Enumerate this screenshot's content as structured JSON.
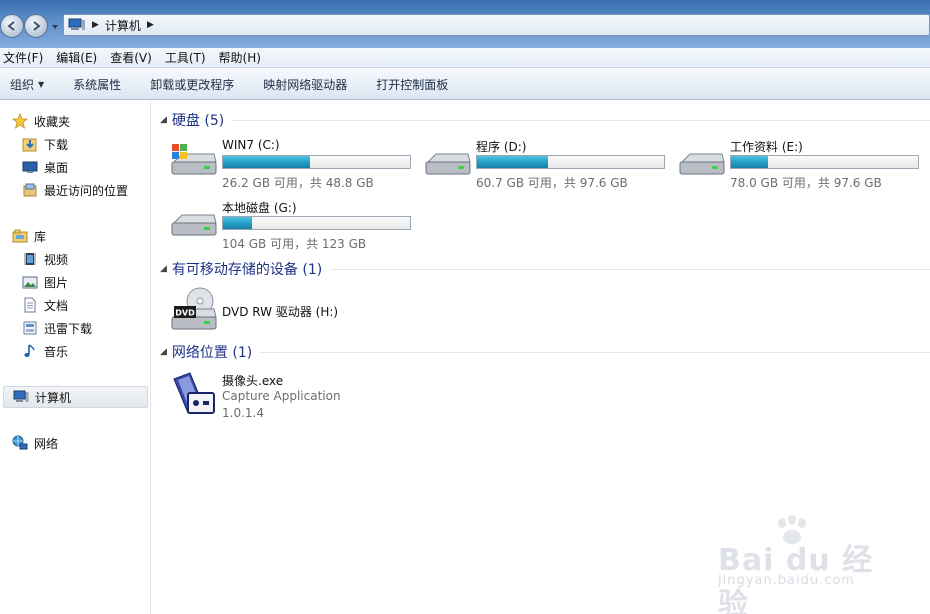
{
  "address": {
    "crumb": "计算机"
  },
  "menu": [
    "文件(F)",
    "编辑(E)",
    "查看(V)",
    "工具(T)",
    "帮助(H)"
  ],
  "toolbar": {
    "organize": "组织",
    "system_properties": "系统属性",
    "uninstall": "卸载或更改程序",
    "map_drive": "映射网络驱动器",
    "control_panel": "打开控制面板"
  },
  "sidebar": {
    "favorites": "收藏夹",
    "favorites_items": [
      "下载",
      "桌面",
      "最近访问的位置"
    ],
    "libraries": "库",
    "library_items": [
      "视频",
      "图片",
      "文档",
      "迅雷下载",
      "音乐"
    ],
    "computer": "计算机",
    "network": "网络"
  },
  "groups": {
    "hard_disks": "硬盘 (5)",
    "removable": "有可移动存储的设备 (1)",
    "network": "网络位置 (1)"
  },
  "drives": [
    {
      "name": "WIN7 (C:)",
      "size": "26.2 GB 可用，共 48.8 GB",
      "used_fraction": 0.463
    },
    {
      "name": "程序 (D:)",
      "size": "60.7 GB 可用，共 97.6 GB",
      "used_fraction": 0.378
    },
    {
      "name": "工作资料 (E:)",
      "size": "78.0 GB 可用，共 97.6 GB",
      "used_fraction": 0.2
    },
    {
      "name": "本地磁盘 (G:)",
      "size": "104 GB 可用，共 123 GB",
      "used_fraction": 0.155
    }
  ],
  "removable": {
    "name": "DVD RW 驱动器 (H:)",
    "icon_label": "DVD"
  },
  "network_item": {
    "name": "摄像头.exe",
    "desc": "Capture Application",
    "version": "1.0.1.4"
  },
  "watermark": {
    "brand": "Bai du 经验",
    "url": "jingyan.baidu.com"
  },
  "colors": {
    "usage_bar": "#26a0c6",
    "group_header": "#1e3287"
  }
}
